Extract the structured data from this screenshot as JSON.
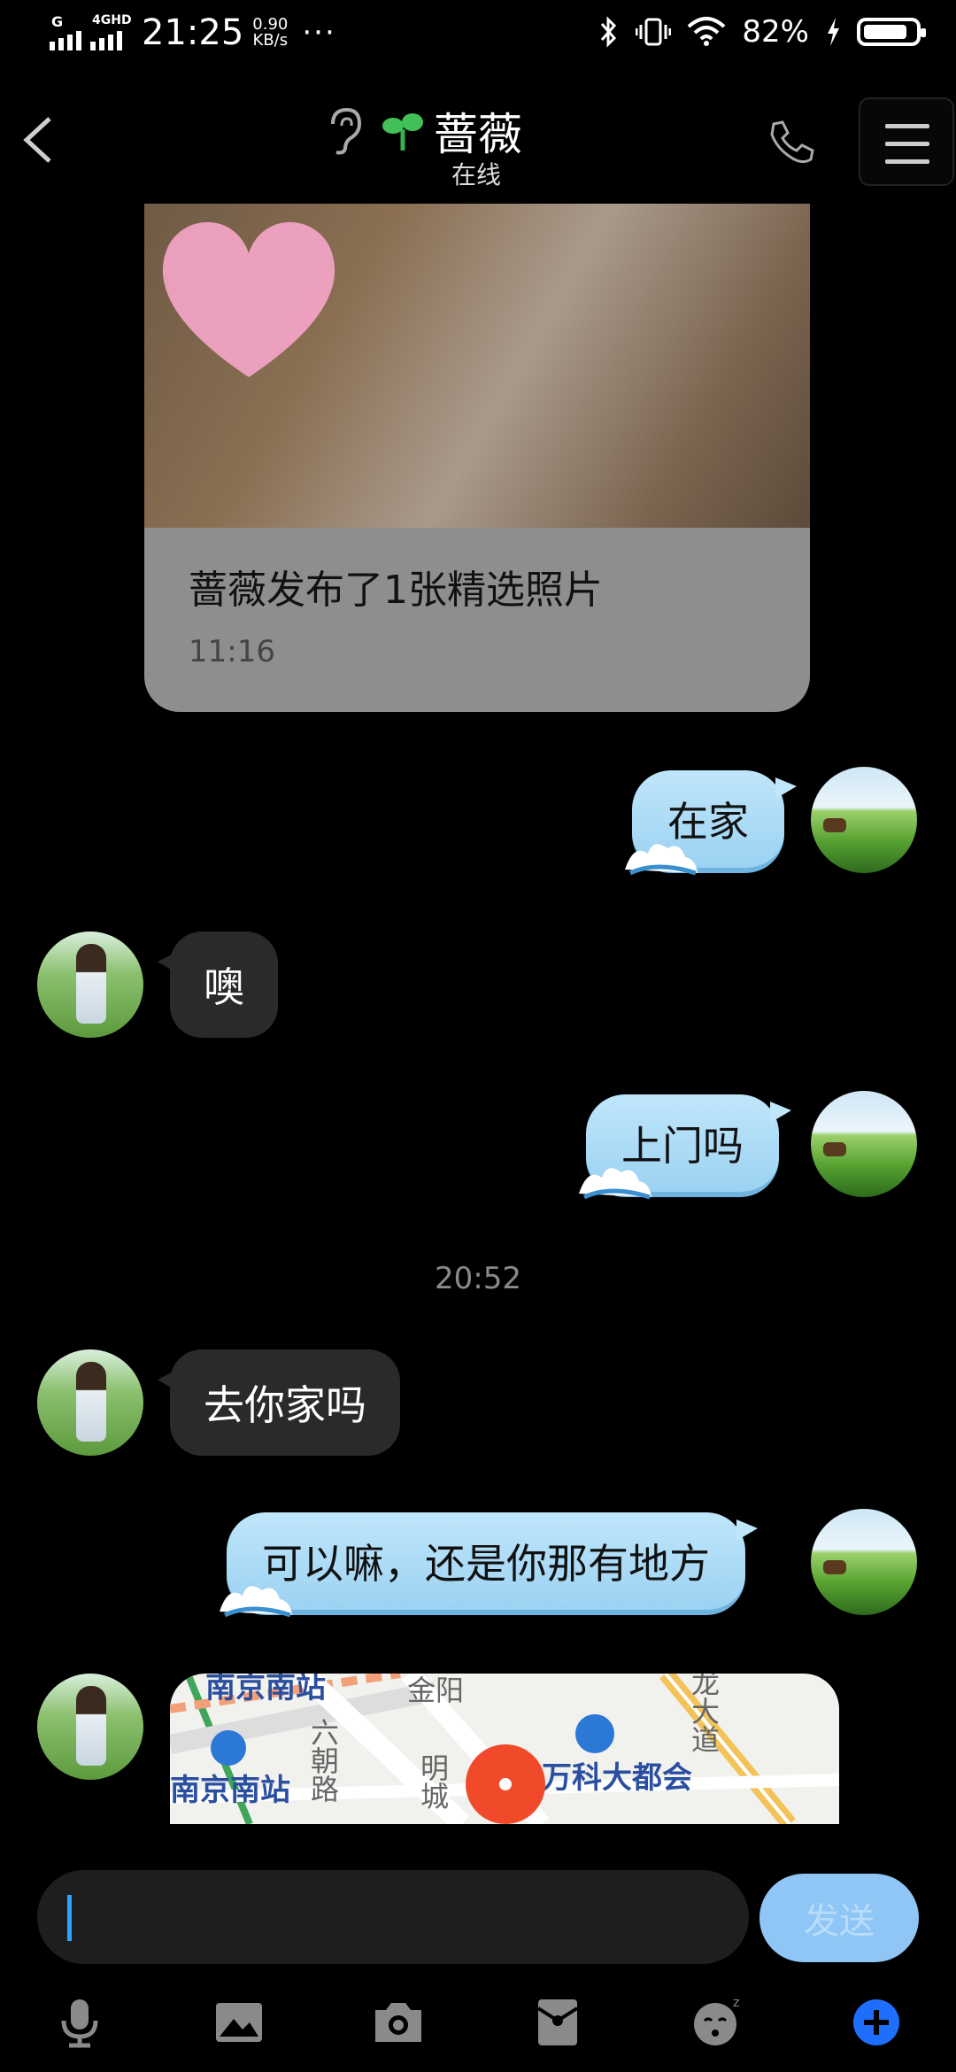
{
  "status_bar": {
    "network_left": "G",
    "network_right": "4GHD",
    "time": "21:25",
    "speed_value": "0.90",
    "speed_unit": "KB/s",
    "more": "···",
    "battery_pct": "82%",
    "battery_level": 0.82
  },
  "header": {
    "name": "蔷薇",
    "status": "在线"
  },
  "share_card": {
    "text": "蔷薇发布了1张精选照片",
    "time": "11:16"
  },
  "messages": [
    {
      "side": "me",
      "text": "在家"
    },
    {
      "side": "her",
      "text": "噢"
    },
    {
      "side": "me",
      "text": "上门吗"
    },
    {
      "side": "her",
      "text": "去你家吗"
    },
    {
      "side": "me",
      "text": "可以嘛，还是你那有地方"
    }
  ],
  "time_divider": "20:52",
  "map": {
    "label_top": "南京南站",
    "label_station": "南京南站",
    "label_mall": "万科大都会",
    "road_1": "六朝路",
    "road_2": "明城",
    "road_3": "金阳",
    "road_4": "龙大道"
  },
  "composer": {
    "placeholder": "",
    "send_label": "发送"
  },
  "toolbar": [
    "voice-icon",
    "image-icon",
    "camera-icon",
    "red-packet-icon",
    "emoji-icon",
    "plus-icon"
  ],
  "colors": {
    "accent_blue": "#2aa4ff",
    "bubble_me": "#bfe6fb",
    "bubble_her": "#2a2a2a",
    "send_button": "#8fc6f5"
  }
}
